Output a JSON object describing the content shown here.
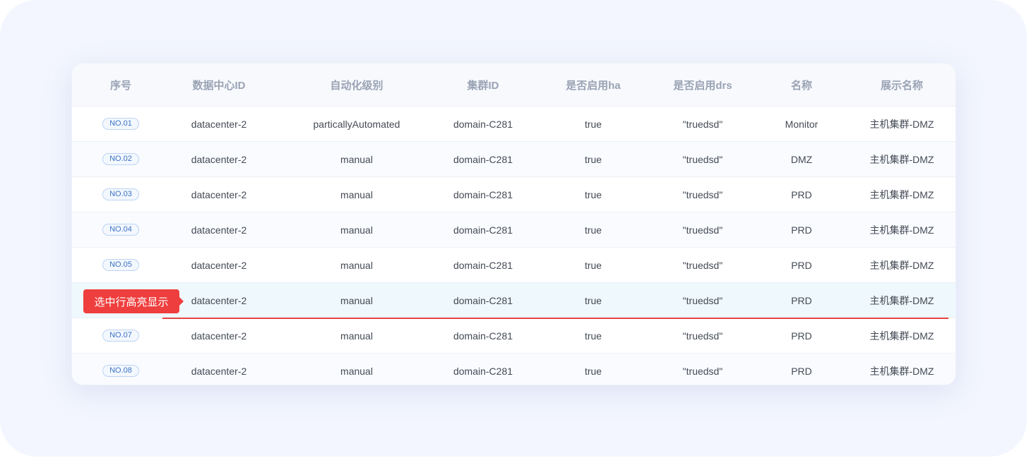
{
  "table": {
    "headers": [
      "序号",
      "数据中心ID",
      "自动化级别",
      "集群ID",
      "是否启用ha",
      "是否启用drs",
      "名称",
      "展示名称"
    ],
    "rows": [
      {
        "no": "NO.01",
        "datacenter": "datacenter-2",
        "automation": "particallyAutomated",
        "cluster": "domain-C281",
        "ha": "true",
        "drs": "\"truedsd\"",
        "name": "Monitor",
        "display": "主机集群-DMZ"
      },
      {
        "no": "NO.02",
        "datacenter": "datacenter-2",
        "automation": "manual",
        "cluster": "domain-C281",
        "ha": "true",
        "drs": "\"truedsd\"",
        "name": "DMZ",
        "display": "主机集群-DMZ"
      },
      {
        "no": "NO.03",
        "datacenter": "datacenter-2",
        "automation": "manual",
        "cluster": "domain-C281",
        "ha": "true",
        "drs": "\"truedsd\"",
        "name": "PRD",
        "display": "主机集群-DMZ"
      },
      {
        "no": "NO.04",
        "datacenter": "datacenter-2",
        "automation": "manual",
        "cluster": "domain-C281",
        "ha": "true",
        "drs": "\"truedsd\"",
        "name": "PRD",
        "display": "主机集群-DMZ"
      },
      {
        "no": "NO.05",
        "datacenter": "datacenter-2",
        "automation": "manual",
        "cluster": "domain-C281",
        "ha": "true",
        "drs": "\"truedsd\"",
        "name": "PRD",
        "display": "主机集群-DMZ"
      },
      {
        "no": "",
        "datacenter": "datacenter-2",
        "automation": "manual",
        "cluster": "domain-C281",
        "ha": "true",
        "drs": "\"truedsd\"",
        "name": "PRD",
        "display": "主机集群-DMZ"
      },
      {
        "no": "NO.07",
        "datacenter": "datacenter-2",
        "automation": "manual",
        "cluster": "domain-C281",
        "ha": "true",
        "drs": "\"truedsd\"",
        "name": "PRD",
        "display": "主机集群-DMZ"
      },
      {
        "no": "NO.08",
        "datacenter": "datacenter-2",
        "automation": "manual",
        "cluster": "domain-C281",
        "ha": "true",
        "drs": "\"truedsd\"",
        "name": "PRD",
        "display": "主机集群-DMZ"
      }
    ],
    "selected_row": 5
  },
  "callout": {
    "label": "选中行高亮显示",
    "color": "#ee3e3d"
  },
  "colors": {
    "badge_text": "#3a72c4",
    "selected_row_bg": "#eff8fc",
    "highlight_line": "#e8443f"
  }
}
